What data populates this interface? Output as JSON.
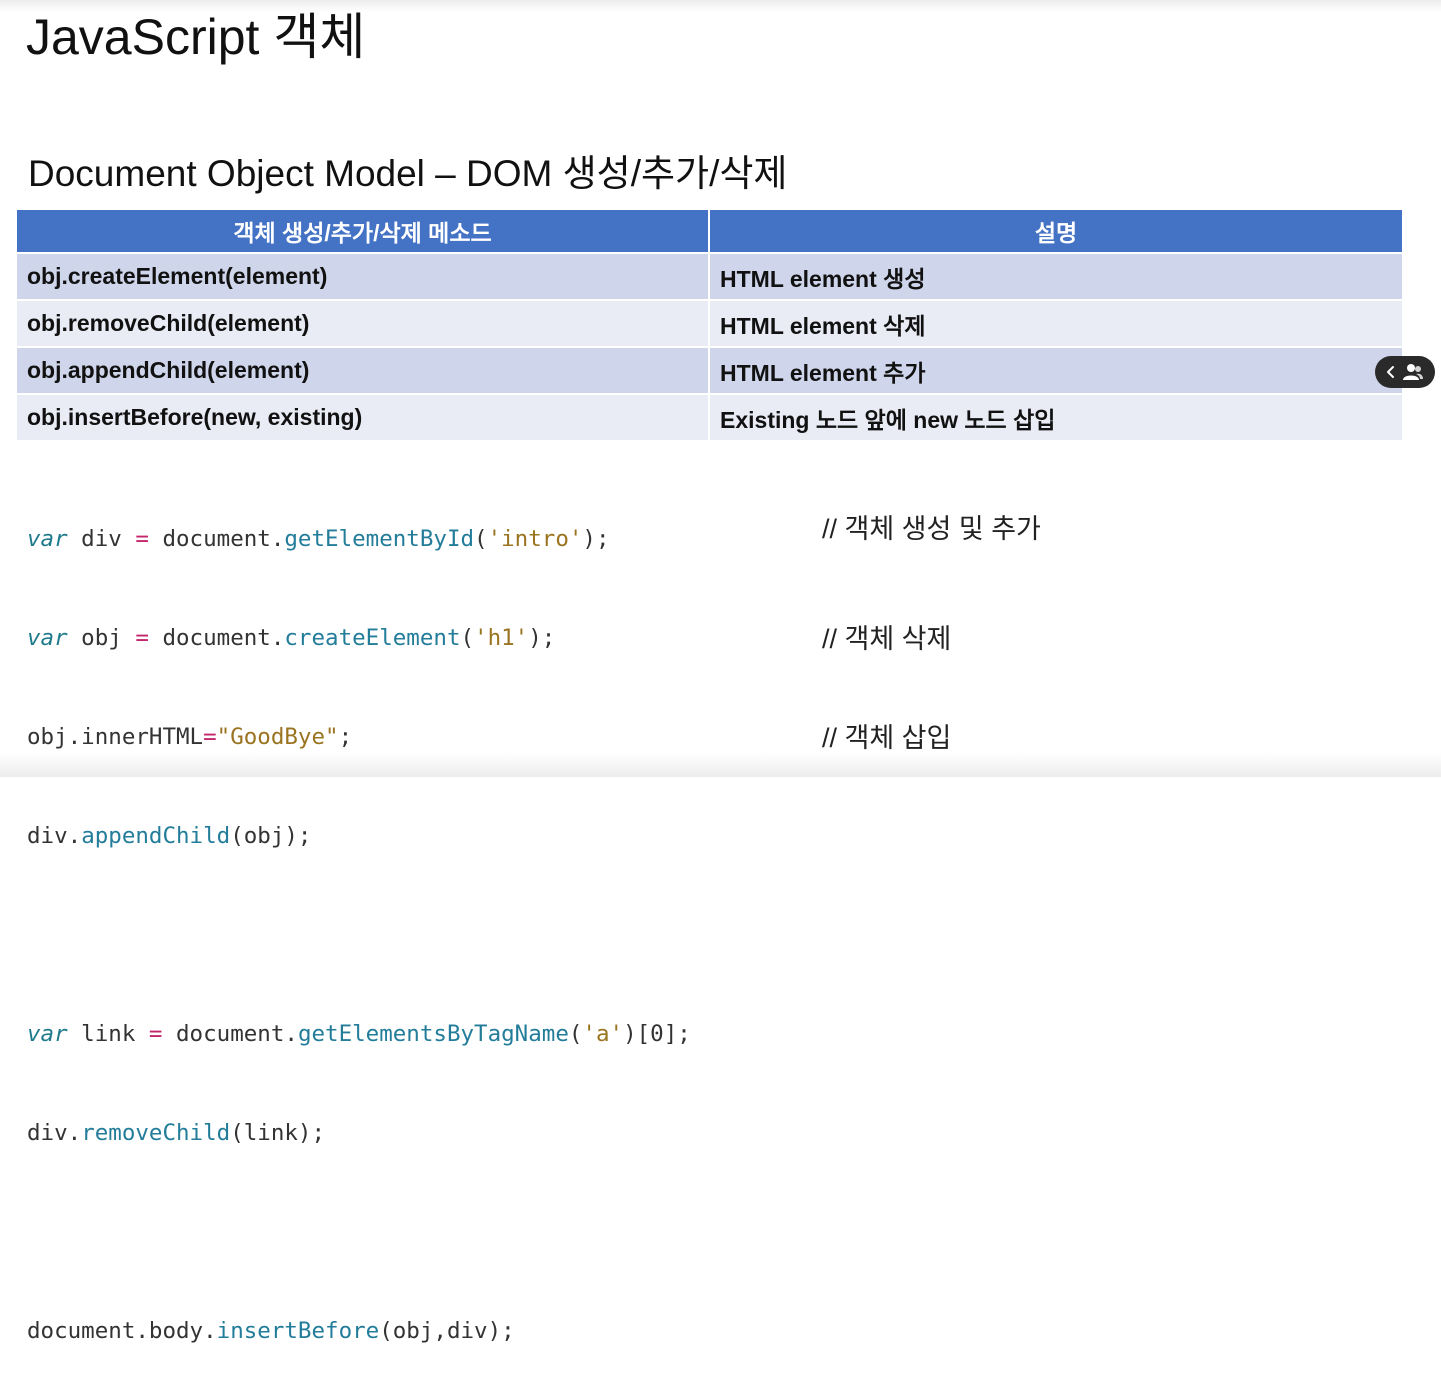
{
  "slide": {
    "title": "JavaScript 객체",
    "subtitle": "Document Object Model – DOM 생성/추가/삭제"
  },
  "table": {
    "header": {
      "method": "객체 생성/추가/삭제 메소드",
      "description": "설명"
    },
    "rows": [
      {
        "method": "obj.createElement(element)",
        "description": "HTML element 생성"
      },
      {
        "method": "obj.removeChild(element)",
        "description": "HTML element 삭제"
      },
      {
        "method": "obj.appendChild(element)",
        "description": "HTML element 추가"
      },
      {
        "method": "obj.insertBefore(new, existing)",
        "description": "Existing 노드 앞에 new 노드 삽입"
      }
    ]
  },
  "code": {
    "line1": {
      "kw": "var",
      "a": " div ",
      "op": "=",
      "b": " document.",
      "fn": "getElementById",
      "c": "(",
      "str": "'intro'",
      "d": ");"
    },
    "line2": {
      "kw": "var",
      "a": " obj ",
      "op": "=",
      "b": " document.",
      "fn": "createElement",
      "c": "(",
      "str": "'h1'",
      "d": ");"
    },
    "line3": {
      "a": "obj.innerHTML",
      "op": "=",
      "str": "\"GoodBye\"",
      "d": ";"
    },
    "line4": {
      "a": "div.",
      "fn": "appendChild",
      "d": "(obj);"
    },
    "line5": {
      "kw": "var",
      "a": " link ",
      "op": "=",
      "b": " document.",
      "fn": "getElementsByTagName",
      "c": "(",
      "str": "'a'",
      "d": ")[0];"
    },
    "line6": {
      "a": "div.",
      "fn": "removeChild",
      "d": "(link);"
    },
    "line7": {
      "a": "document.body.",
      "fn": "insertBefore",
      "d": "(obj,div);"
    }
  },
  "comments": {
    "create_append": "// 객체 생성 및 추가",
    "remove": "// 객체 삭제",
    "insert": "// 객체 삽입"
  },
  "overlay": {
    "icons": [
      "chevron-left-icon",
      "person-icon"
    ]
  }
}
